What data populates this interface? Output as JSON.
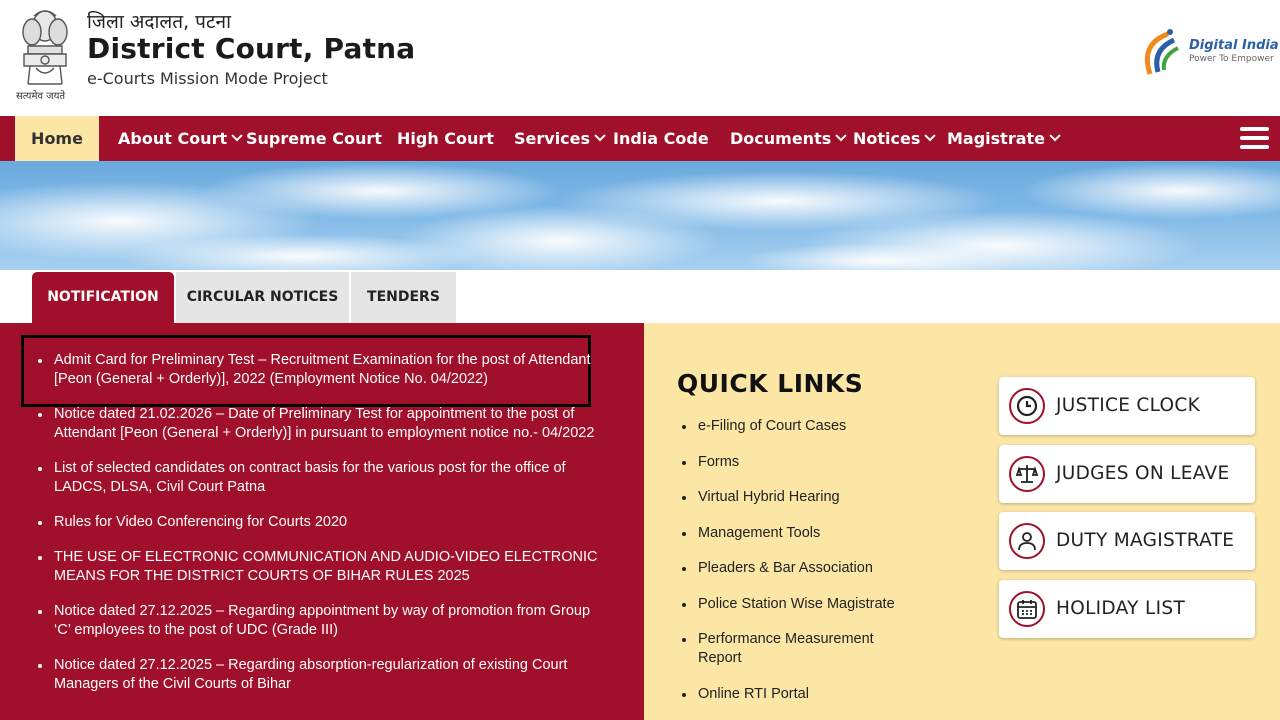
{
  "header": {
    "title_hindi": "जिला अदालत, पटना",
    "title": "District Court, Patna",
    "subtitle": "e-Courts Mission Mode Project",
    "emblem_caption": "सत्यमेव जयते",
    "digital_india_name": "Digital India",
    "digital_india_tagline": "Power To Empower"
  },
  "nav": {
    "items": [
      {
        "label": "Home",
        "active": true,
        "dropdown": false
      },
      {
        "label": "About Court",
        "dropdown": true
      },
      {
        "label": "Supreme Court",
        "dropdown": false
      },
      {
        "label": "High Court",
        "dropdown": false
      },
      {
        "label": "Services",
        "dropdown": true
      },
      {
        "label": "India Code",
        "dropdown": false
      },
      {
        "label": "Documents",
        "dropdown": true
      },
      {
        "label": "Notices",
        "dropdown": true
      },
      {
        "label": "Magistrate",
        "dropdown": true
      }
    ],
    "menu_icon": "hamburger-icon"
  },
  "tabs": [
    {
      "label": "NOTIFICATION",
      "active": true
    },
    {
      "label": "CIRCULAR NOTICES",
      "active": false
    },
    {
      "label": "TENDERS",
      "active": false
    }
  ],
  "notifications": [
    "Admit Card for Preliminary Test – Recruitment Examination for the post of Attendant [Peon (General + Orderly)], 2022 (Employment Notice No. 04/2022)",
    "Notice dated 21.02.2026 – Date of Preliminary Test for appointment to the post of Attendant [Peon (General + Orderly)] in pursuant to employment notice no.- 04/2022",
    "List of selected candidates on contract basis for the various post for the office of LADCS, DLSA, Civil Court Patna",
    "Rules for Video Conferencing for Courts 2020",
    "THE USE OF ELECTRONIC COMMUNICATION AND AUDIO-VIDEO ELECTRONIC MEANS FOR THE DISTRICT COURTS OF BIHAR RULES 2025",
    "Notice dated 27.12.2025 – Regarding appointment by way of promotion from Group ‘C’ employees to the post of UDC (Grade III)",
    "Notice dated 27.12.2025 – Regarding absorption-regularization of existing Court Managers of the Civil Courts of Bihar"
  ],
  "quick_links": {
    "title": "QUICK LINKS",
    "items": [
      "e-Filing of Court Cases",
      "Forms",
      "Virtual Hybrid Hearing",
      "Management Tools",
      "Pleaders & Bar Association",
      "Police Station Wise Magistrate",
      "Performance Measurement Report",
      "Online RTI Portal"
    ],
    "buttons": [
      {
        "label": "JUSTICE CLOCK",
        "icon": "clock-icon"
      },
      {
        "label": "JUDGES ON LEAVE",
        "icon": "scales-icon"
      },
      {
        "label": "DUTY MAGISTRATE",
        "icon": "person-icon"
      },
      {
        "label": "HOLIDAY LIST",
        "icon": "calendar-icon"
      }
    ]
  },
  "colors": {
    "primary": "#a0102a",
    "home_tab": "#fbe6a6",
    "quick_links_bg": "#fbe6a6"
  }
}
